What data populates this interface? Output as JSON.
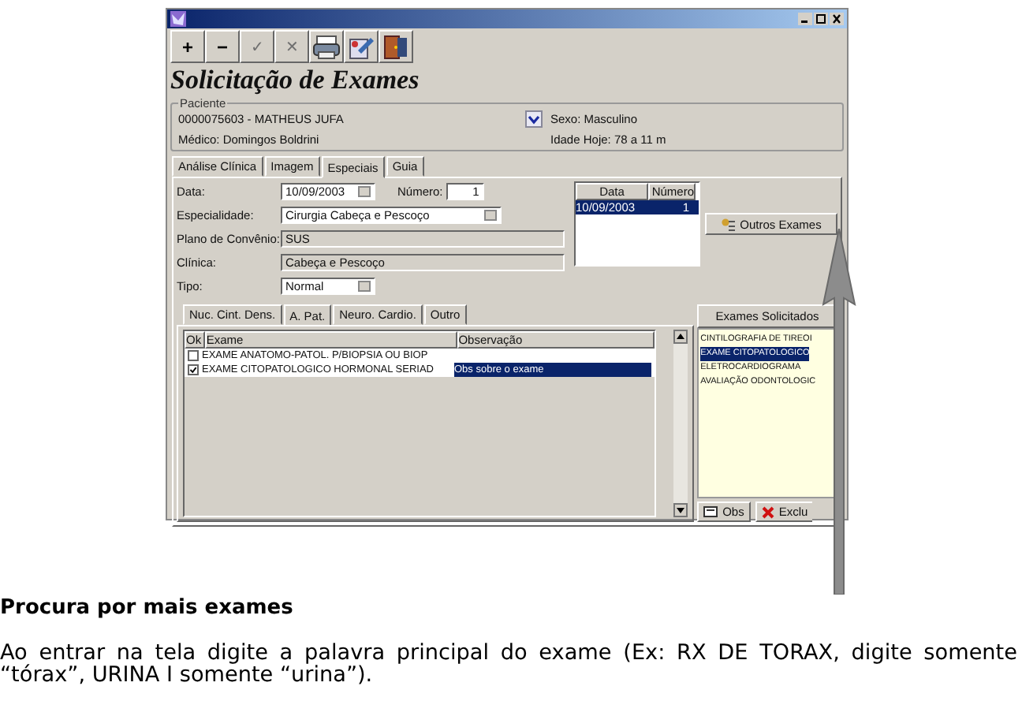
{
  "toolbar": [
    {
      "label": "+",
      "disabled": false
    },
    {
      "label": "−",
      "disabled": false
    },
    {
      "label": "✓",
      "disabled": true
    },
    {
      "label": "✕",
      "disabled": true
    }
  ],
  "heading": "Solicitação de Exames",
  "patient": {
    "legend": "Paciente",
    "name": "0000075603 - MATHEUS JUFA",
    "doctor": "Médico: Domingos Boldrini",
    "sex": "Sexo: Masculino",
    "age": "Idade Hoje: 78 a 11 m"
  },
  "tabs": [
    {
      "label": "Análise Clínica",
      "selected": false
    },
    {
      "label": "Imagem",
      "selected": false
    },
    {
      "label": "Especiais",
      "selected": true
    },
    {
      "label": "Guia",
      "selected": false
    }
  ],
  "form": {
    "date_label": "Data:",
    "date": "10/09/2003",
    "number_label": "Número:",
    "number": "1",
    "specialty_label": "Especialidade:",
    "specialty": "Cirurgia Cabeça e Pescoço",
    "plan_label": "Plano de Convênio:",
    "plan": "SUS",
    "clinic_label": "Clínica:",
    "clinic": "Cabeça e Pescoço",
    "type_label": "Tipo:",
    "type": "Normal"
  },
  "requests_table": {
    "columns": [
      "Data",
      "Número"
    ],
    "rows": [
      {
        "cells": [
          "10/09/2003",
          "1"
        ],
        "selected": true
      }
    ]
  },
  "other_exams_button": "Outros Exames",
  "subtabs": [
    {
      "label": "Nuc. Cint. Dens.",
      "selected": false
    },
    {
      "label": "A. Pat.",
      "selected": true
    },
    {
      "label": "Neuro. Cardio.",
      "selected": false
    },
    {
      "label": "Outro",
      "selected": false
    }
  ],
  "exam_grid": {
    "columns": [
      "Ok",
      "Exame",
      "Observação"
    ],
    "rows": [
      {
        "checked": false,
        "exam": "EXAME ANATOMO-PATOL. P/BIOPSIA OU BIOP",
        "selected": false
      },
      {
        "checked": true,
        "exam": "EXAME CITOPATOLOGICO HORMONAL SERIAD",
        "note": "Obs sobre o exame",
        "selected": true
      }
    ]
  },
  "requested": {
    "title": "Exames Solicitados",
    "items": [
      {
        "label": "CINTILOGRAFIA DE TIREOI",
        "selected": false
      },
      {
        "label": "EXAME CITOPATOLOGICO",
        "selected": true
      },
      {
        "label": "ELETROCARDIOGRAMA",
        "selected": false
      },
      {
        "label": "AVALIAÇÃO ODONTOLOGIC",
        "selected": false
      }
    ],
    "obs_button": "Obs",
    "delete_button": "Exclu"
  },
  "doc": {
    "heading": "Procura por mais exames",
    "paragraph": "Ao entrar na tela digite a palavra principal do exame (Ex: RX DE TORAX, digite somente “tórax”, URINA I somente “urina”)."
  }
}
